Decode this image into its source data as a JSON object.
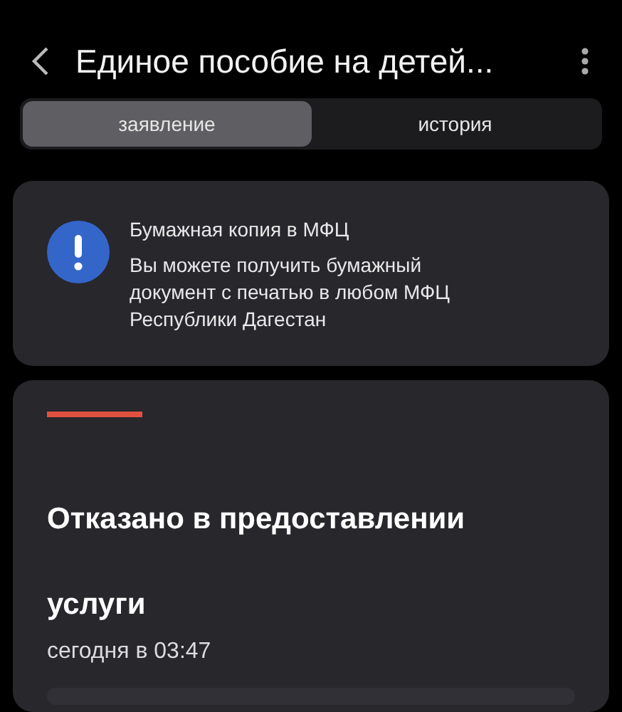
{
  "header": {
    "title": "Единое пособие на детей..."
  },
  "tabs": [
    {
      "label": "заявление",
      "selected": true
    },
    {
      "label": "история",
      "selected": false
    }
  ],
  "notice": {
    "title": "Бумажная копия в МФЦ",
    "text": "Вы можете получить бумажный документ с печатью в любом МФЦ Республики Дагестан"
  },
  "status": {
    "kind": "rejected",
    "title_lines": [
      "Отказано в предоставлении",
      "услуги"
    ],
    "time": "сегодня в 03:47"
  }
}
